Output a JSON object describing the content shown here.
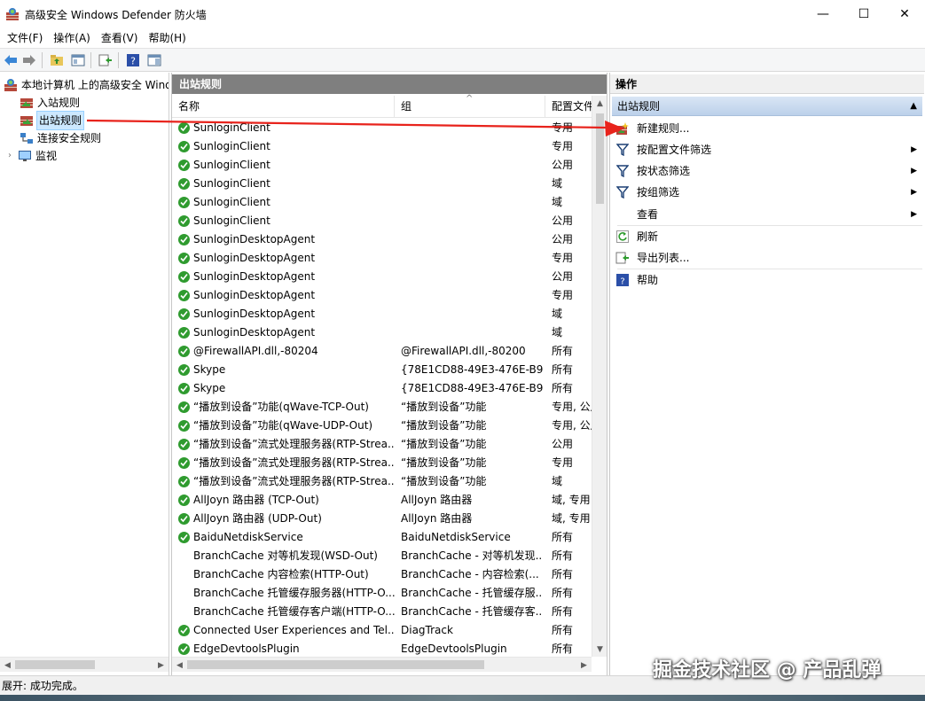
{
  "window": {
    "title": "高级安全 Windows Defender 防火墙",
    "minimize": "—",
    "maximize": "☐",
    "close": "✕"
  },
  "menu": [
    "文件(F)",
    "操作(A)",
    "查看(V)",
    "帮助(H)"
  ],
  "tree": {
    "root": "本地计算机 上的高级安全 Windows Defender 防火墙",
    "items": [
      "入站规则",
      "出站规则",
      "连接安全规则",
      "监视"
    ],
    "selected": "出站规则"
  },
  "middle": {
    "header": "出站规则",
    "columns": [
      "名称",
      "组",
      "配置文件"
    ],
    "rows": [
      {
        "name": "SunloginClient",
        "group": "",
        "profile": "专用",
        "enabled": true
      },
      {
        "name": "SunloginClient",
        "group": "",
        "profile": "专用",
        "enabled": true
      },
      {
        "name": "SunloginClient",
        "group": "",
        "profile": "公用",
        "enabled": true
      },
      {
        "name": "SunloginClient",
        "group": "",
        "profile": "域",
        "enabled": true
      },
      {
        "name": "SunloginClient",
        "group": "",
        "profile": "域",
        "enabled": true
      },
      {
        "name": "SunloginClient",
        "group": "",
        "profile": "公用",
        "enabled": true
      },
      {
        "name": "SunloginDesktopAgent",
        "group": "",
        "profile": "公用",
        "enabled": true
      },
      {
        "name": "SunloginDesktopAgent",
        "group": "",
        "profile": "专用",
        "enabled": true
      },
      {
        "name": "SunloginDesktopAgent",
        "group": "",
        "profile": "公用",
        "enabled": true
      },
      {
        "name": "SunloginDesktopAgent",
        "group": "",
        "profile": "专用",
        "enabled": true
      },
      {
        "name": "SunloginDesktopAgent",
        "group": "",
        "profile": "域",
        "enabled": true
      },
      {
        "name": "SunloginDesktopAgent",
        "group": "",
        "profile": "域",
        "enabled": true
      },
      {
        "name": "@FirewallAPI.dll,-80204",
        "group": "@FirewallAPI.dll,-80200",
        "profile": "所有",
        "enabled": true
      },
      {
        "name": "Skype",
        "group": "{78E1CD88-49E3-476E-B9...",
        "profile": "所有",
        "enabled": true
      },
      {
        "name": "Skype",
        "group": "{78E1CD88-49E3-476E-B9...",
        "profile": "所有",
        "enabled": true
      },
      {
        "name": "“播放到设备”功能(qWave-TCP-Out)",
        "group": "“播放到设备”功能",
        "profile": "专用, 公用",
        "enabled": true
      },
      {
        "name": "“播放到设备”功能(qWave-UDP-Out)",
        "group": "“播放到设备”功能",
        "profile": "专用, 公用",
        "enabled": true
      },
      {
        "name": "“播放到设备”流式处理服务器(RTP-Strea...",
        "group": "“播放到设备”功能",
        "profile": "公用",
        "enabled": true
      },
      {
        "name": "“播放到设备”流式处理服务器(RTP-Strea...",
        "group": "“播放到设备”功能",
        "profile": "专用",
        "enabled": true
      },
      {
        "name": "“播放到设备”流式处理服务器(RTP-Strea...",
        "group": "“播放到设备”功能",
        "profile": "域",
        "enabled": true
      },
      {
        "name": "AllJoyn 路由器 (TCP-Out)",
        "group": "AllJoyn 路由器",
        "profile": "域, 专用",
        "enabled": true
      },
      {
        "name": "AllJoyn 路由器 (UDP-Out)",
        "group": "AllJoyn 路由器",
        "profile": "域, 专用",
        "enabled": true
      },
      {
        "name": "BaiduNetdiskService",
        "group": "BaiduNetdiskService",
        "profile": "所有",
        "enabled": true
      },
      {
        "name": "BranchCache 对等机发现(WSD-Out)",
        "group": "BranchCache - 对等机发现...",
        "profile": "所有",
        "enabled": false
      },
      {
        "name": "BranchCache 内容检索(HTTP-Out)",
        "group": "BranchCache - 内容检索(...",
        "profile": "所有",
        "enabled": false
      },
      {
        "name": "BranchCache 托管缓存服务器(HTTP-O...",
        "group": "BranchCache - 托管缓存服...",
        "profile": "所有",
        "enabled": false
      },
      {
        "name": "BranchCache 托管缓存客户端(HTTP-O...",
        "group": "BranchCache - 托管缓存客...",
        "profile": "所有",
        "enabled": false
      },
      {
        "name": "Connected User Experiences and Tel...",
        "group": "DiagTrack",
        "profile": "所有",
        "enabled": true
      },
      {
        "name": "EdgeDevtoolsPlugin",
        "group": "EdgeDevtoolsPlugin",
        "profile": "所有",
        "enabled": true
      }
    ]
  },
  "actions": {
    "header": "操作",
    "section": "出站规则",
    "items": [
      {
        "label": "新建规则...",
        "icon": "new-rule-icon",
        "submenu": false
      },
      {
        "label": "按配置文件筛选",
        "icon": "filter-icon",
        "submenu": true
      },
      {
        "label": "按状态筛选",
        "icon": "filter-icon",
        "submenu": true
      },
      {
        "label": "按组筛选",
        "icon": "filter-icon",
        "submenu": true
      },
      {
        "label": "查看",
        "icon": "",
        "submenu": true
      },
      {
        "label": "刷新",
        "icon": "refresh-icon",
        "submenu": false
      },
      {
        "label": "导出列表...",
        "icon": "export-icon",
        "submenu": false
      },
      {
        "label": "帮助",
        "icon": "help-icon",
        "submenu": false
      }
    ]
  },
  "status": "展开: 成功完成。",
  "watermark": "掘金技术社区 @ 产品乱弹",
  "colors": {
    "pane_header": "#7f7f7f",
    "section_bg": "#c9dbf0",
    "enabled_green": "#2f9b2f",
    "arrow_red": "#e8231c"
  }
}
